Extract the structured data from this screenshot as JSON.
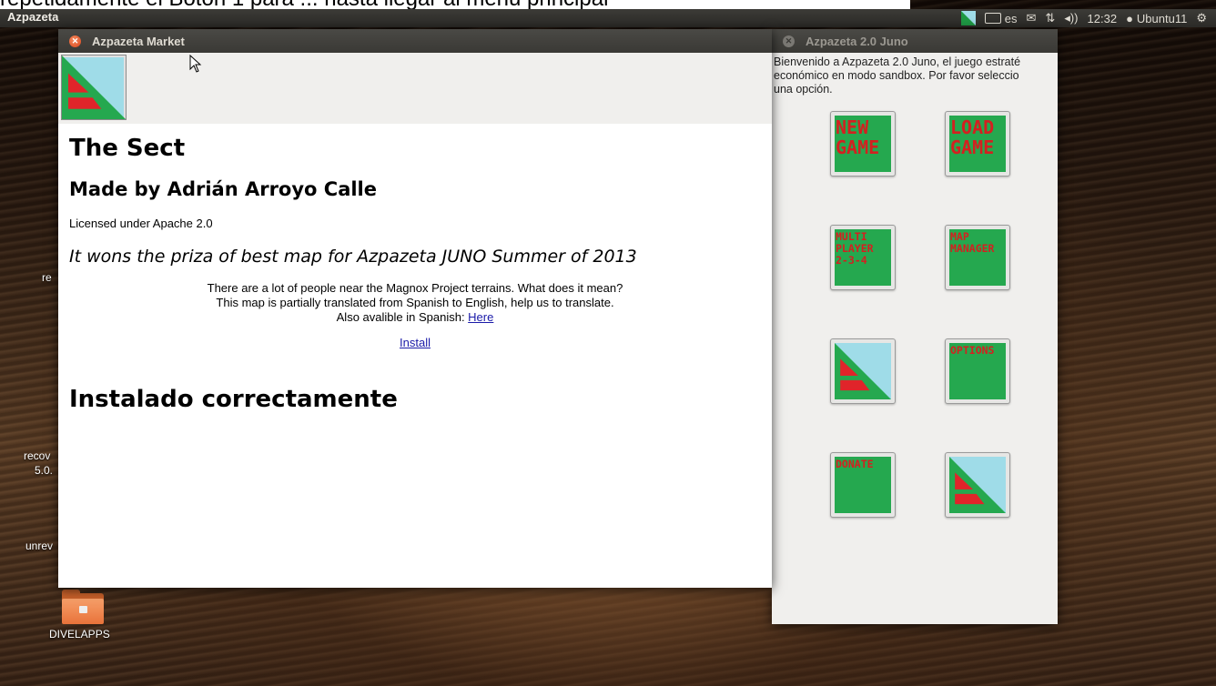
{
  "caption": "repetidamente el Boton 1 para ... hasta llegar al menu principal",
  "panel": {
    "app_name": "Azpazeta",
    "lang": "es",
    "time": "12:32",
    "user": "Ubuntu11"
  },
  "desktop_labels": [
    "re",
    "recov",
    "5.0.",
    "unrev",
    "DIVELAPPS"
  ],
  "market_window": {
    "title": "Azpazeta Market",
    "map_title": "The Sect",
    "author": "Made by Adrián Arroyo Calle",
    "license": "Licensed under Apache 2.0",
    "award": "It wons the priza of best map for Azpazeta JUNO Summer of 2013",
    "desc_line1": "There are a lot of people near the Magnox Project terrains. What does it mean?",
    "desc_line2": "This map is partially translated from Spanish to English, help us to translate.",
    "desc_line3_prefix": "Also avalible in Spanish: ",
    "desc_link": "Here",
    "install_link": "Install",
    "success": "Instalado correctamente"
  },
  "juno_window": {
    "title": "Azpazeta 2.0 Juno",
    "welcome_line1": "Bienvenido a Azpazeta 2.0 Juno, el juego estraté",
    "welcome_line2": "económico en modo sandbox. Por favor seleccio",
    "welcome_line3": "una opción.",
    "buttons": {
      "new_game": [
        "NEW",
        "GAME"
      ],
      "load_game": [
        "LOAD",
        "GAME"
      ],
      "multiplayer": [
        "MULTI",
        "PLAYER",
        "2-3-4"
      ],
      "map_manager": [
        "MAP",
        "MANAGER"
      ],
      "options": "OPTIONS",
      "donate": "DONATE"
    }
  },
  "colors": {
    "accent_green": "#25a84f",
    "accent_red": "#d42020",
    "logo_sky": "#9fdce8",
    "link_blue": "#1a1aa8"
  }
}
